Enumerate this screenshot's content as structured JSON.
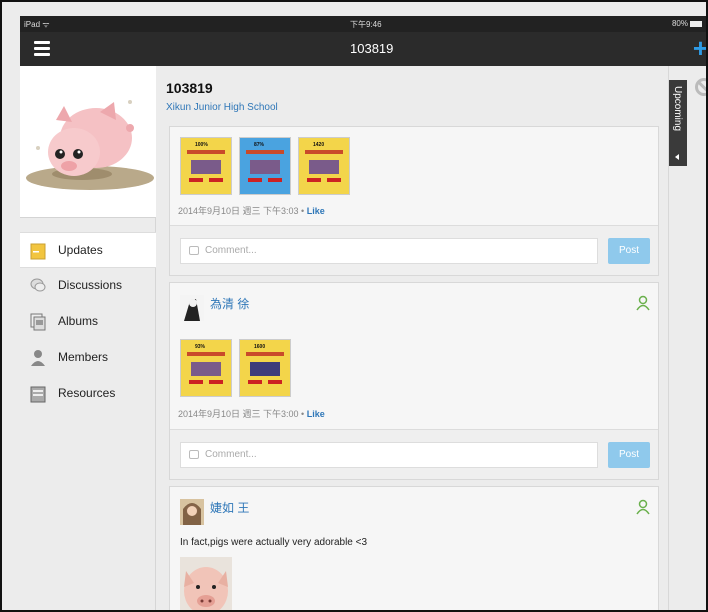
{
  "status_bar": {
    "carrier": "iPad ᯤ",
    "time": "下午9:46",
    "battery": "80%"
  },
  "nav": {
    "title": "103819"
  },
  "group": {
    "name": "103819",
    "school": "Xikun Junior High School"
  },
  "sidebar": {
    "items": [
      {
        "label": "Updates",
        "icon": "updates-icon"
      },
      {
        "label": "Discussions",
        "icon": "discussions-icon"
      },
      {
        "label": "Albums",
        "icon": "albums-icon"
      },
      {
        "label": "Members",
        "icon": "members-icon"
      },
      {
        "label": "Resources",
        "icon": "resources-icon"
      }
    ]
  },
  "right_panel": {
    "upcoming_label": "Upcoming"
  },
  "posts": [
    {
      "thumbs": [
        {
          "caption": "100%",
          "color": "#f3d54a"
        },
        {
          "caption": "87%",
          "color": "#4aa3e0"
        },
        {
          "caption": "1420",
          "color": "#f3d54a"
        }
      ],
      "meta": "2014年9月10日 週三 下午3:03 • ",
      "like": "Like",
      "comment_placeholder": "Comment...",
      "post_label": "Post"
    },
    {
      "poster": "為清 徐",
      "thumbs": [
        {
          "caption": "93%",
          "color": "#f3d54a"
        },
        {
          "caption": "1600",
          "color": "#f3d54a"
        }
      ],
      "meta": "2014年9月10日 週三 下午3:00 • ",
      "like": "Like",
      "comment_placeholder": "Comment...",
      "post_label": "Post"
    },
    {
      "poster": "婕如 王",
      "text": "In fact,pigs were actually very adorable <3"
    }
  ]
}
